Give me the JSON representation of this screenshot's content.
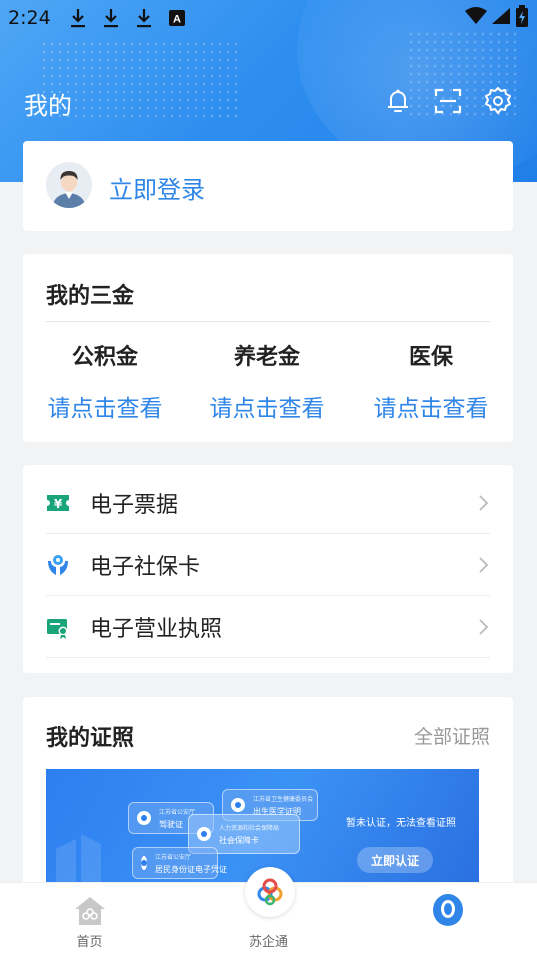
{
  "status_bar": {
    "time": "2:24",
    "downloads": [
      "download-icon",
      "download-icon",
      "download-icon"
    ],
    "extra_icon": "A"
  },
  "header": {
    "title": "我的",
    "icons": [
      "bell-icon",
      "scan-icon",
      "gear-icon"
    ]
  },
  "login": {
    "label": "立即登录"
  },
  "funds": {
    "title": "我的三金",
    "items": [
      {
        "name": "公积金",
        "link": "请点击查看"
      },
      {
        "name": "养老金",
        "link": "请点击查看"
      },
      {
        "name": "医保",
        "link": "请点击查看"
      }
    ]
  },
  "services": {
    "items": [
      {
        "label": "电子票据",
        "icon": "ticket-icon"
      },
      {
        "label": "电子社保卡",
        "icon": "social-security-icon"
      },
      {
        "label": "电子营业执照",
        "icon": "business-license-icon"
      }
    ]
  },
  "certificates": {
    "title": "我的证照",
    "all_label": "全部证照",
    "banner": {
      "cards": [
        {
          "line1": "江苏省公安厅",
          "line2": "驾驶证"
        },
        {
          "line1": "人力资源和社会保障局",
          "line2": "社会保障卡"
        },
        {
          "line1": "江苏省卫生健康委员会",
          "line2": "出生医学证明"
        },
        {
          "line1": "江苏省公安厅",
          "line2": "居民身份证电子凭证"
        }
      ],
      "note": "暂未认证，无法查看证照",
      "button": "立即认证"
    }
  },
  "tabbar": {
    "items": [
      {
        "label": "首页",
        "icon": "home-icon"
      },
      {
        "label": "苏企通",
        "icon": "su-qi-tong-logo-icon"
      },
      {
        "label": "",
        "icon": "profile-icon"
      }
    ]
  },
  "colors": {
    "accent": "#2f86e8",
    "header_blue": "#2f8ff0",
    "green_icon": "#1aa47a"
  }
}
